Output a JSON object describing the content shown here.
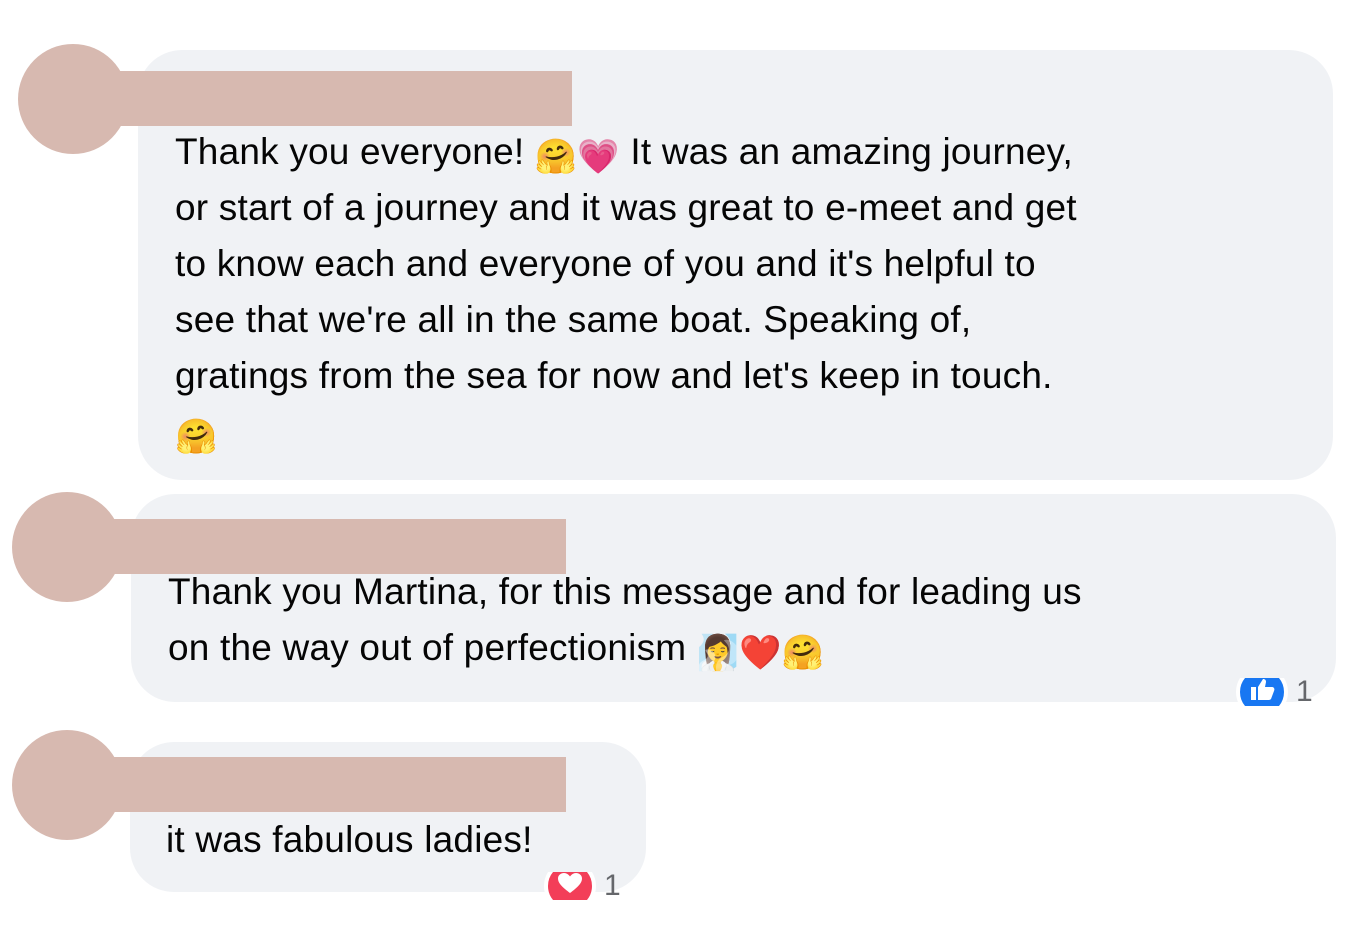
{
  "comments": [
    {
      "text_part1": "Thank you everyone! ",
      "emoji_a": "🤗",
      "emoji_b": "💗",
      "text_part2": " It was an amazing journey,\nor start of a journey and it was great to e-meet and get\nto know each and everyone of you and it's helpful to\nsee that we're all in the same boat. Speaking of,\ngratings from the sea for now and let's keep in touch.\n",
      "emoji_end": "🤗"
    },
    {
      "text": "Thank you Martina, for this message and for leading us\non the way out of perfectionism ",
      "emoji_a": "🧖‍♀️",
      "emoji_b": "❤️",
      "emoji_c": "🤗",
      "reaction": {
        "icon": "like-icon",
        "count": "1",
        "color": "#1877f2"
      }
    },
    {
      "text": "it was fabulous ladies!",
      "reaction": {
        "icon": "heart-icon",
        "count": "1",
        "color": "#f33e58"
      }
    }
  ],
  "colors": {
    "bubble_bg": "#f0f2f5",
    "redaction": "#d7b9b0",
    "text": "#050505"
  }
}
